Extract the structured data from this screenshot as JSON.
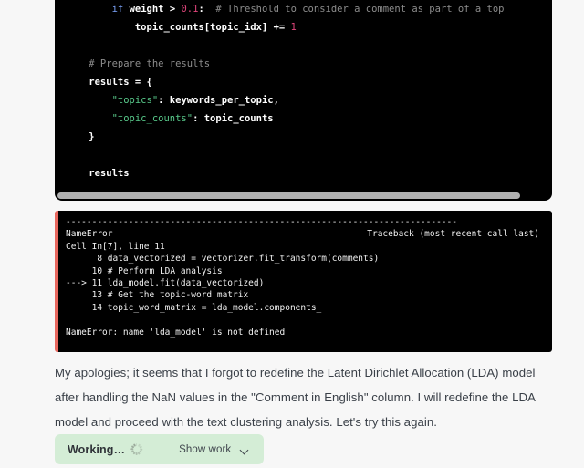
{
  "page": {
    "background": "#f7f7f7",
    "text_color": "#3a4048"
  },
  "code_block": {
    "background": "#000000",
    "has_horizontal_scrollbar": true,
    "lines": [
      {
        "id": "line-if-weight",
        "segments": [
          {
            "text": "        ",
            "type": "plain"
          },
          {
            "text": "if",
            "type": "kw"
          },
          {
            "text": " ",
            "type": "plain"
          },
          {
            "text": "weight",
            "type": "name"
          },
          {
            "text": " > ",
            "type": "op"
          },
          {
            "text": "0.1",
            "type": "num"
          },
          {
            "text": ":",
            "type": "op"
          },
          {
            "text": "  # Threshold to consider a comment as part of a top",
            "type": "comment"
          }
        ]
      },
      {
        "id": "line-topic-counts-incr",
        "segments": [
          {
            "text": "            topic_counts[topic_idx] += ",
            "type": "plain"
          },
          {
            "text": "1",
            "type": "num"
          }
        ]
      },
      {
        "id": "line-blank-1",
        "segments": [
          {
            "text": " ",
            "type": "plain"
          }
        ]
      },
      {
        "id": "line-comment-prepare",
        "segments": [
          {
            "text": "    # Prepare the results",
            "type": "comment"
          }
        ]
      },
      {
        "id": "line-results-open",
        "segments": [
          {
            "text": "    results = {",
            "type": "plain"
          }
        ]
      },
      {
        "id": "line-topics-key",
        "segments": [
          {
            "text": "        ",
            "type": "plain"
          },
          {
            "text": "\"topics\"",
            "type": "str"
          },
          {
            "text": ": keywords_per_topic,",
            "type": "plain"
          }
        ]
      },
      {
        "id": "line-topic-counts-key",
        "segments": [
          {
            "text": "        ",
            "type": "plain"
          },
          {
            "text": "\"topic_counts\"",
            "type": "str"
          },
          {
            "text": ": topic_counts",
            "type": "plain"
          }
        ]
      },
      {
        "id": "line-results-close",
        "segments": [
          {
            "text": "    }",
            "type": "plain"
          }
        ]
      },
      {
        "id": "line-blank-2",
        "segments": [
          {
            "text": " ",
            "type": "plain"
          }
        ]
      },
      {
        "id": "line-results-return",
        "segments": [
          {
            "text": "    results",
            "type": "plain"
          }
        ]
      }
    ]
  },
  "error_block": {
    "background": "#000000",
    "accent_color": "#e8685f",
    "divider": "---------------------------------------------------------------------------",
    "header_left": "NameError",
    "header_right": "Traceback (most recent call last)",
    "lines": [
      "Cell In[7], line 11",
      "      8 data_vectorized = vectorizer.fit_transform(comments)",
      "     10 # Perform LDA analysis",
      "---> 11 lda_model.fit(data_vectorized)",
      "     13 # Get the topic-word matrix",
      "     14 topic_word_matrix = lda_model.components_",
      "",
      "NameError: name 'lda_model' is not defined"
    ]
  },
  "assistant_message": {
    "text": "My apologies; it seems that I forgot to redefine the Latent Dirichlet Allocation (LDA) model after handling the NaN values in the \"Comment in English\" column. I will redefine the LDA model and proceed with the text clustering analysis. Let's try this again."
  },
  "working_pill": {
    "background": "#d4edd6",
    "status_label": "Working…",
    "spinner_icon": "loading-spinner-icon",
    "show_work_label": "Show work",
    "chevron_icon": "chevron-down-icon"
  }
}
